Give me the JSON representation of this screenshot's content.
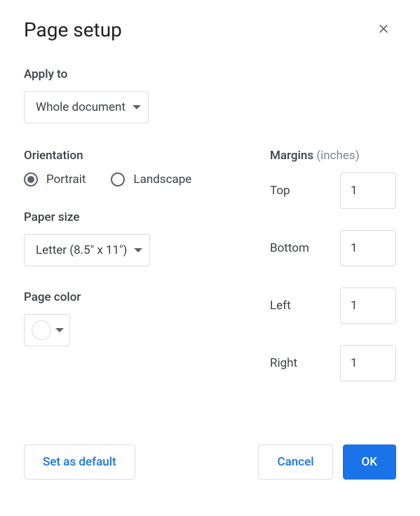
{
  "dialog": {
    "title": "Page setup"
  },
  "apply": {
    "label": "Apply to",
    "selected": "Whole document"
  },
  "orientation": {
    "label": "Orientation",
    "portrait": "Portrait",
    "landscape": "Landscape",
    "selected": "portrait"
  },
  "paper": {
    "label": "Paper size",
    "selected": "Letter (8.5\" x 11\")"
  },
  "color": {
    "label": "Page color",
    "value": "#ffffff"
  },
  "margins": {
    "label": "Margins",
    "unit": "(inches)",
    "top_label": "Top",
    "bottom_label": "Bottom",
    "left_label": "Left",
    "right_label": "Right",
    "top": "1",
    "bottom": "1",
    "left": "1",
    "right": "1"
  },
  "buttons": {
    "set_default": "Set as default",
    "cancel": "Cancel",
    "ok": "OK"
  }
}
